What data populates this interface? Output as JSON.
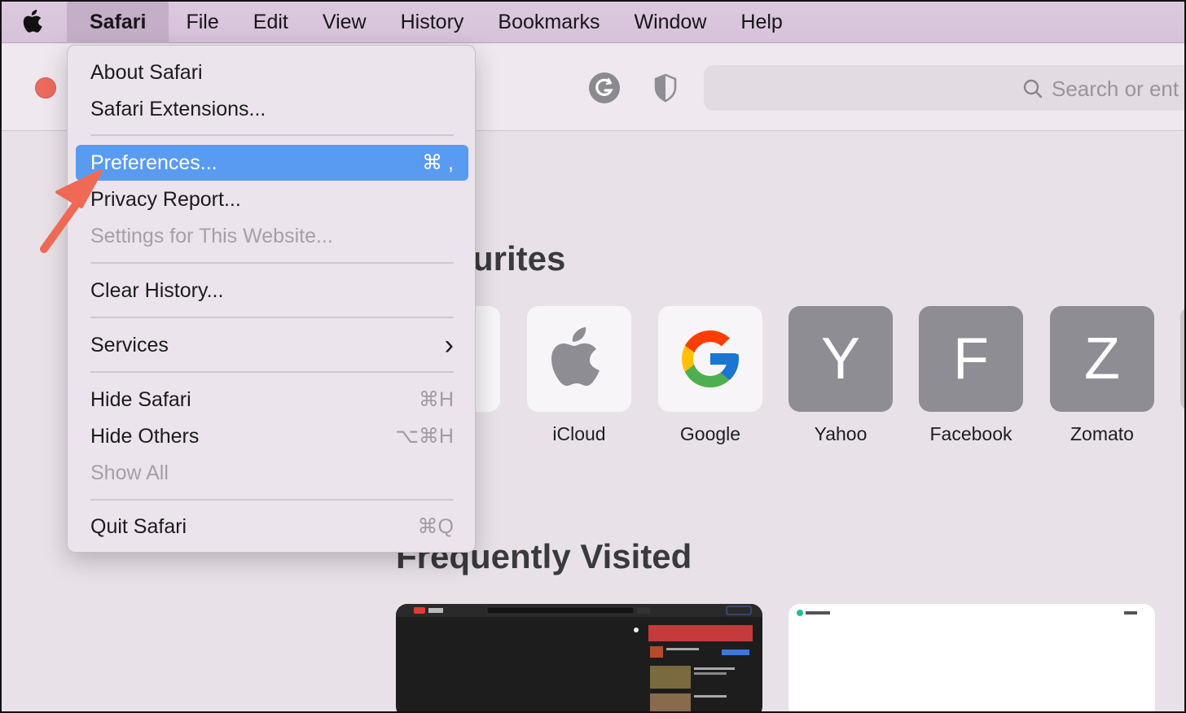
{
  "menubar": {
    "app_name": "Safari",
    "items": [
      "File",
      "Edit",
      "View",
      "History",
      "Bookmarks",
      "Window",
      "Help"
    ]
  },
  "toolbar": {
    "search_placeholder": "Search or ent"
  },
  "safari_menu": {
    "about": "About Safari",
    "extensions": "Safari Extensions...",
    "preferences": "Preferences...",
    "preferences_shortcut": "⌘ ,",
    "privacy_report": "Privacy Report...",
    "settings_website": "Settings for This Website...",
    "clear_history": "Clear History...",
    "services": "Services",
    "services_chevron": "›",
    "hide_safari": "Hide Safari",
    "hide_safari_shortcut": "⌘H",
    "hide_others": "Hide Others",
    "hide_others_shortcut": "⌥⌘H",
    "show_all": "Show All",
    "quit": "Quit Safari",
    "quit_shortcut": "⌘Q"
  },
  "favourites": {
    "heading": "urites",
    "items": [
      {
        "label": "iCloud",
        "icon": "apple-logo-icon"
      },
      {
        "label": "Google",
        "icon": "google-g-icon"
      },
      {
        "label": "Yahoo",
        "letter": "Y"
      },
      {
        "label": "Facebook",
        "letter": "F"
      },
      {
        "label": "Zomato",
        "letter": "Z"
      }
    ]
  },
  "frequently_visited": {
    "heading": "Frequently Visited"
  },
  "colors": {
    "menubar_bg": "#ddc9df",
    "selection": "#5a9bf2",
    "traffic_red": "#ec6a5e",
    "arrow": "#ef6a55",
    "letter_tile": "#8e8d93"
  }
}
